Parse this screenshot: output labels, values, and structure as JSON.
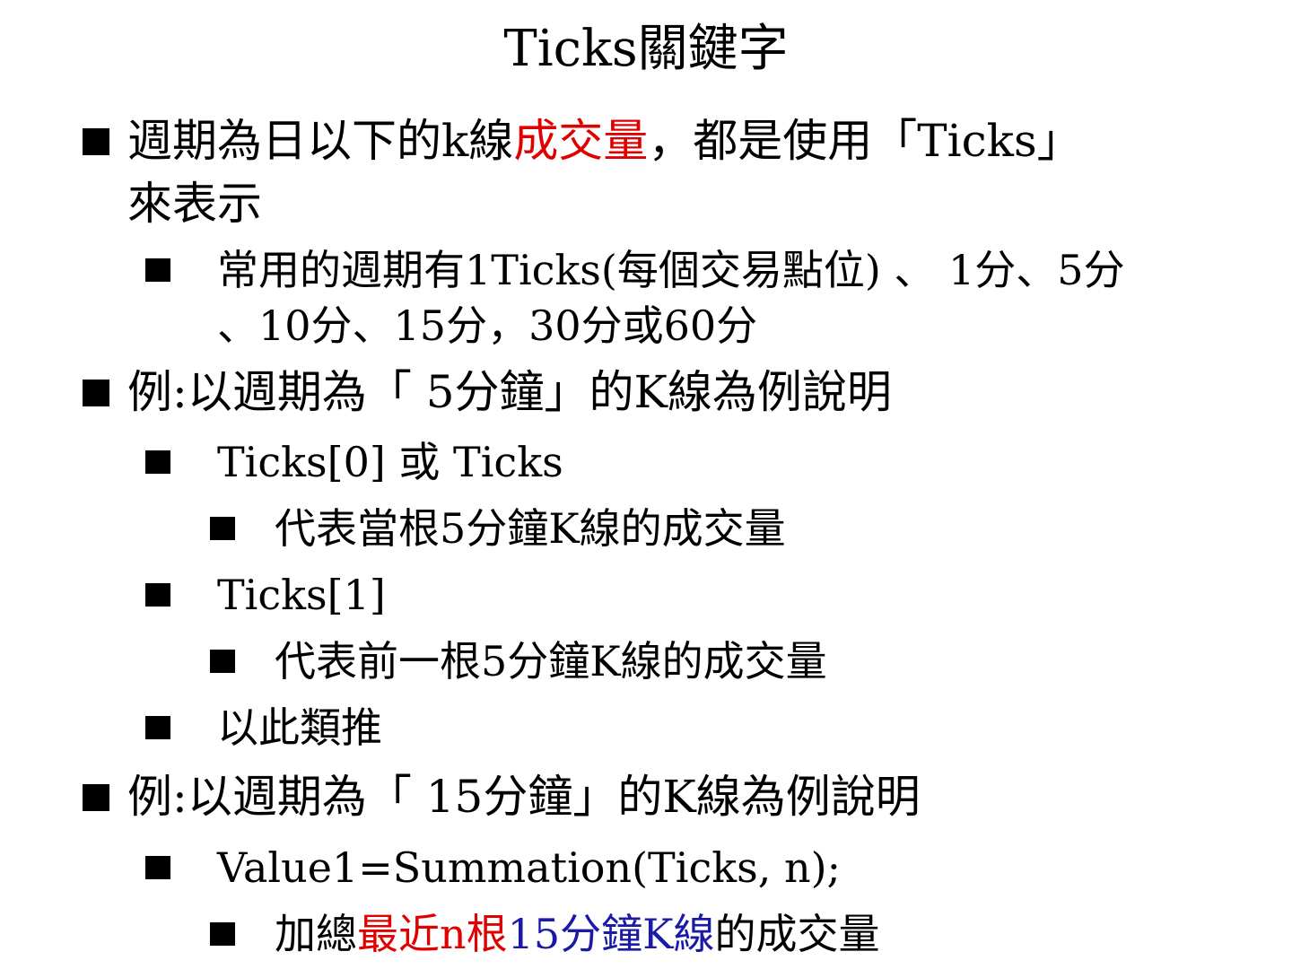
{
  "title": "Ticks關鍵字",
  "colors": {
    "red": "#e00000",
    "blue": "#1a1aa6",
    "text": "#000000"
  },
  "bullets": {
    "b1": {
      "line1_pre": "週期為日以下的k線",
      "line1_red": "成交量",
      "line1_post": "，都是使用「Ticks」",
      "line2": "來表示"
    },
    "b1_sub1": {
      "line1": "常用的週期有1Ticks(每個交易點位) 、 1分、5分",
      "line2": "、10分、15分，30分或60分"
    },
    "b2": {
      "text": "例:以週期為「 5分鐘」的K線為例說明"
    },
    "b2_sub1": {
      "text": "Ticks[0] 或 Ticks"
    },
    "b2_sub1_sub1": {
      "text": "代表當根5分鐘K線的成交量"
    },
    "b2_sub2": {
      "text": "Ticks[1]"
    },
    "b2_sub2_sub1": {
      "text": "代表前一根5分鐘K線的成交量"
    },
    "b2_sub3": {
      "text": "以此類推"
    },
    "b3": {
      "text": "例:以週期為「 15分鐘」的K線為例說明"
    },
    "b3_sub1": {
      "text": "Value1=Summation(Ticks, n);"
    },
    "b3_sub1_sub1": {
      "pre": "加總",
      "red": "最近n根",
      "blue": "15分鐘K線",
      "post": "的成交量"
    }
  }
}
